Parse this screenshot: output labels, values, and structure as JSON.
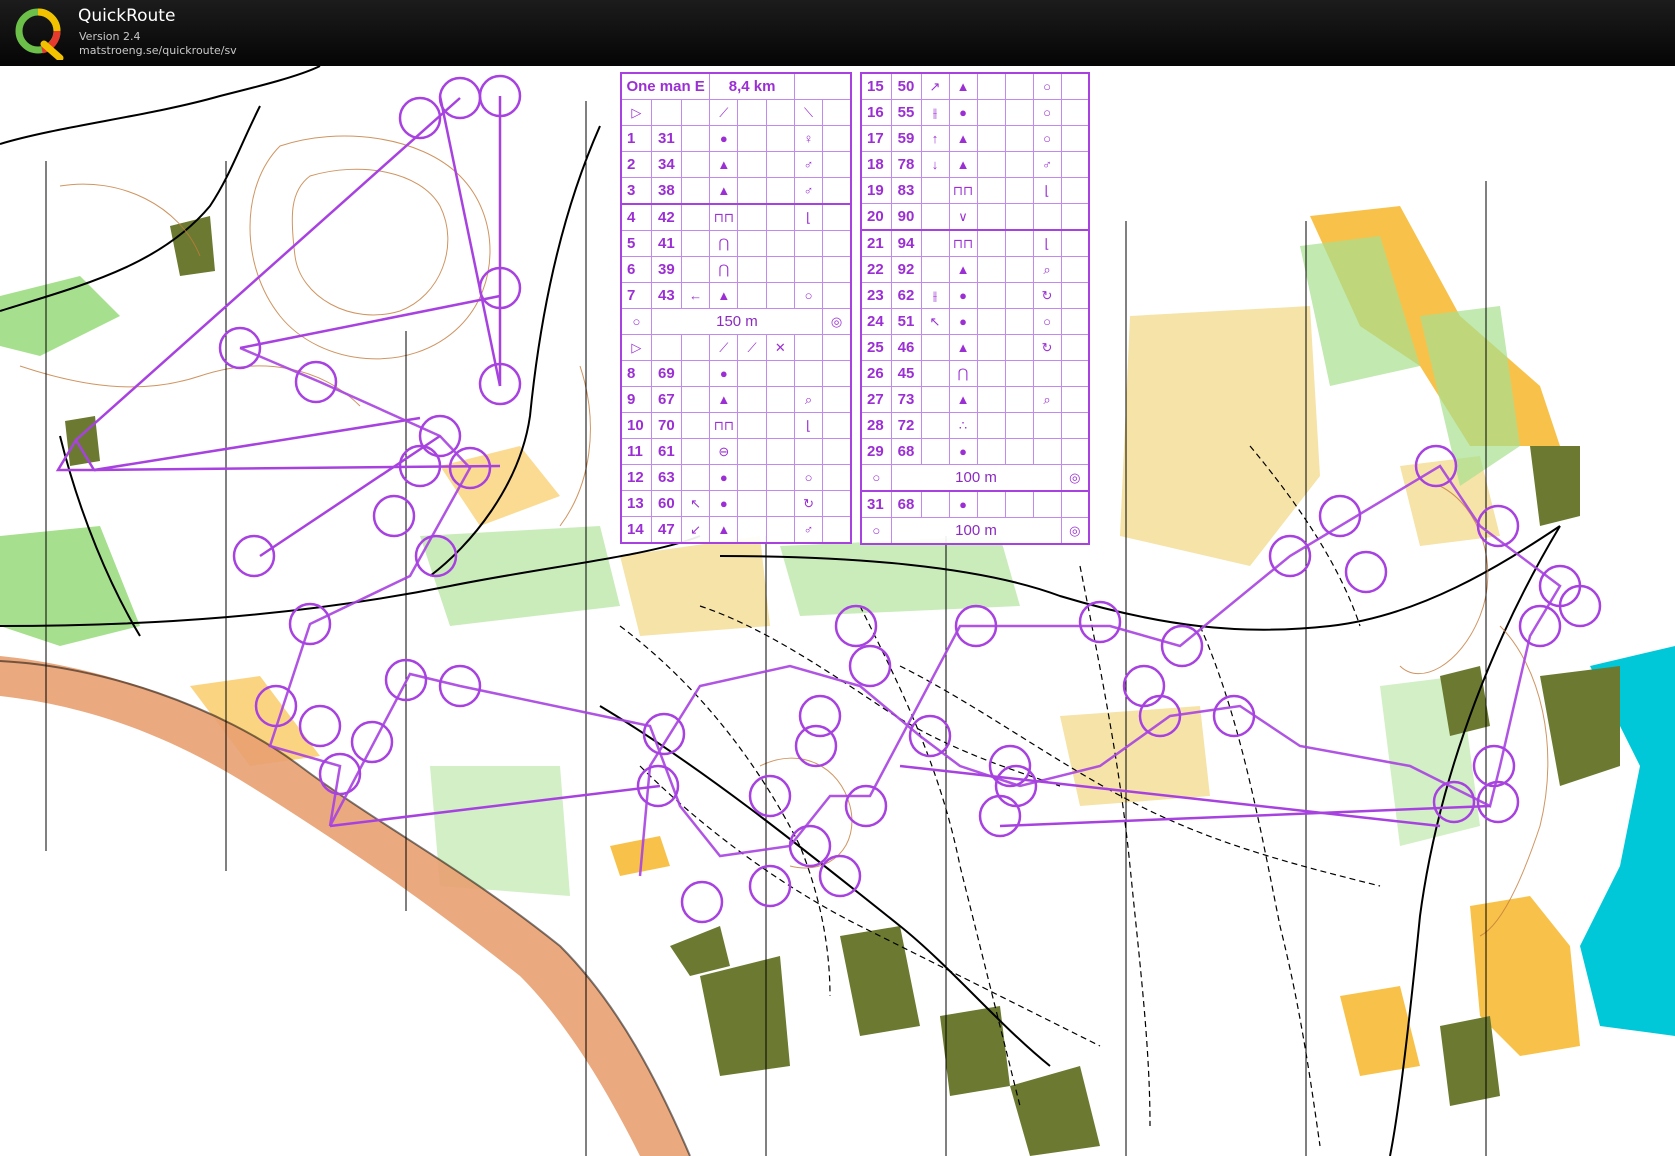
{
  "app": {
    "title": "QuickRoute",
    "version": "Version 2.4",
    "url": "matstroeng.se/quickroute/sv",
    "logo_icon": "quickroute-q-logo-icon"
  },
  "colors": {
    "course_purple": "#a742e0",
    "open_land": "#f8c24a",
    "forest_green": "#9fd98a",
    "water": "#00c8d8",
    "road": "#e8a070",
    "building": "#6b7a30"
  },
  "course": {
    "name": "One man E",
    "length": "8,4 km",
    "left_table": [
      {
        "n": "1",
        "code": "31",
        "sym": "●",
        "sym2": "♀"
      },
      {
        "n": "2",
        "code": "34",
        "sym": "▲",
        "sym2": "♂"
      },
      {
        "n": "3",
        "code": "38",
        "sym": "▲",
        "sym2": "♂"
      },
      {
        "n": "4",
        "code": "42",
        "sym": "⊓⊓",
        "sym2": "⌊"
      },
      {
        "n": "5",
        "code": "41",
        "sym": "⋂",
        "sym2": ""
      },
      {
        "n": "6",
        "code": "39",
        "sym": "⋂",
        "sym2": ""
      },
      {
        "n": "7",
        "code": "43",
        "sym0": "←",
        "sym": "▲",
        "sym2": "○"
      },
      {
        "n": "8",
        "code": "69",
        "sym": "●",
        "sym2": ""
      },
      {
        "n": "9",
        "code": "67",
        "sym": "▲",
        "sym2": "⌕"
      },
      {
        "n": "10",
        "code": "70",
        "sym": "⊓⊓",
        "sym2": "⌊"
      },
      {
        "n": "11",
        "code": "61",
        "sym": "⊖",
        "sym2": ""
      },
      {
        "n": "12",
        "code": "63",
        "sym": "●",
        "sym2": "○"
      },
      {
        "n": "13",
        "code": "60",
        "sym0": "↖",
        "sym": "●",
        "sym2": "↻"
      },
      {
        "n": "14",
        "code": "47",
        "sym0": "↙",
        "sym": "▲",
        "sym2": "♂"
      }
    ],
    "left_split": "150 m",
    "right_table": [
      {
        "n": "15",
        "code": "50",
        "sym0": "↗",
        "sym": "▲",
        "sym2": "○"
      },
      {
        "n": "16",
        "code": "55",
        "sym0": "⫲",
        "sym": "●",
        "sym2": "○"
      },
      {
        "n": "17",
        "code": "59",
        "sym0": "↑",
        "sym": "▲",
        "sym2": "○"
      },
      {
        "n": "18",
        "code": "78",
        "sym0": "↓",
        "sym": "▲",
        "sym2": "♂"
      },
      {
        "n": "19",
        "code": "83",
        "sym": "⊓⊓",
        "sym2": "⌊"
      },
      {
        "n": "20",
        "code": "90",
        "sym": "∨",
        "sym2": ""
      },
      {
        "n": "21",
        "code": "94",
        "sym": "⊓⊓",
        "sym2": "⌊"
      },
      {
        "n": "22",
        "code": "92",
        "sym": "▲",
        "sym2": "⌕"
      },
      {
        "n": "23",
        "code": "62",
        "sym0": "⫲",
        "sym": "●",
        "sym2": "↻"
      },
      {
        "n": "24",
        "code": "51",
        "sym0": "↖",
        "sym": "●",
        "sym2": "○"
      },
      {
        "n": "25",
        "code": "46",
        "sym": "▲",
        "sym2": "↻"
      },
      {
        "n": "26",
        "code": "45",
        "sym": "⋂",
        "sym2": ""
      },
      {
        "n": "27",
        "code": "73",
        "sym": "▲",
        "sym2": "⌕"
      },
      {
        "n": "28",
        "code": "72",
        "sym": "∴",
        "sym2": ""
      },
      {
        "n": "29",
        "code": "68",
        "sym": "●",
        "sym2": ""
      }
    ],
    "right_split": "100 m",
    "extra_control": {
      "n": "31",
      "code": "68",
      "sym": "●"
    },
    "finish_distance": "100 m"
  }
}
